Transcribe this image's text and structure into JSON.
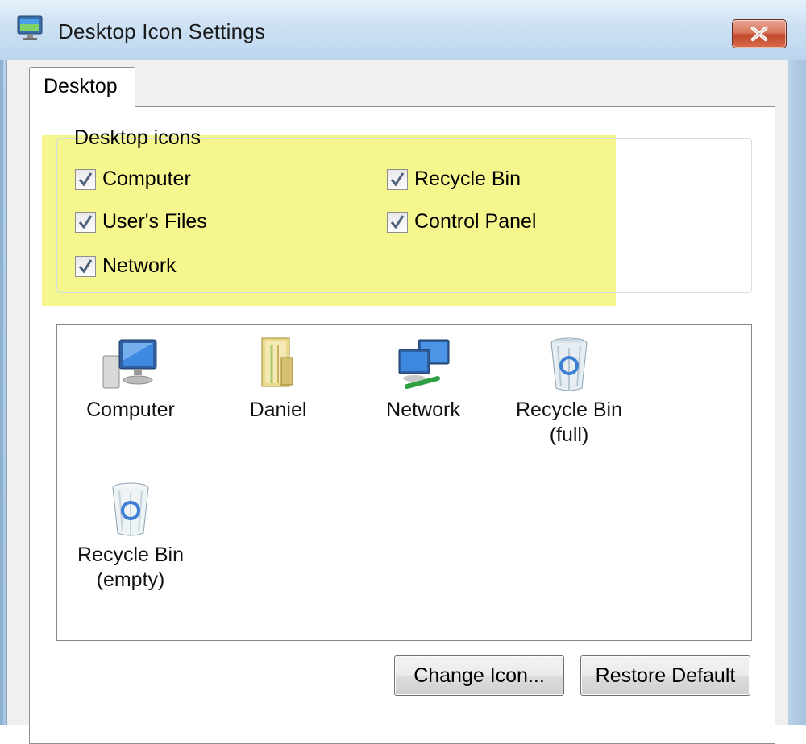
{
  "window": {
    "title": "Desktop Icon Settings",
    "close_label": "close"
  },
  "tabs": [
    {
      "label": "Desktop",
      "selected": true
    }
  ],
  "desktop_icons_group": {
    "title": "Desktop icons",
    "checkboxes": [
      {
        "label": "Computer",
        "checked": true
      },
      {
        "label": "Recycle Bin",
        "checked": true
      },
      {
        "label": "User's Files",
        "checked": true
      },
      {
        "label": "Control Panel",
        "checked": true
      },
      {
        "label": "Network",
        "checked": true
      }
    ]
  },
  "icon_list": {
    "items": [
      {
        "icon": "computer-icon",
        "label_line1": "Computer",
        "label_line2": ""
      },
      {
        "icon": "user-folder-icon",
        "label_line1": "Daniel",
        "label_line2": ""
      },
      {
        "icon": "network-icon",
        "label_line1": "Network",
        "label_line2": ""
      },
      {
        "icon": "recycle-bin-full-icon",
        "label_line1": "Recycle Bin",
        "label_line2": "(full)"
      },
      {
        "icon": "recycle-bin-empty-icon",
        "label_line1": "Recycle Bin",
        "label_line2": "(empty)"
      }
    ]
  },
  "buttons": {
    "change_icon": "Change Icon...",
    "restore_default": "Restore Default"
  },
  "colors": {
    "highlight": "#f3f57a",
    "close_button": "#c24a2c",
    "titlebar": "#cfe2f4"
  }
}
